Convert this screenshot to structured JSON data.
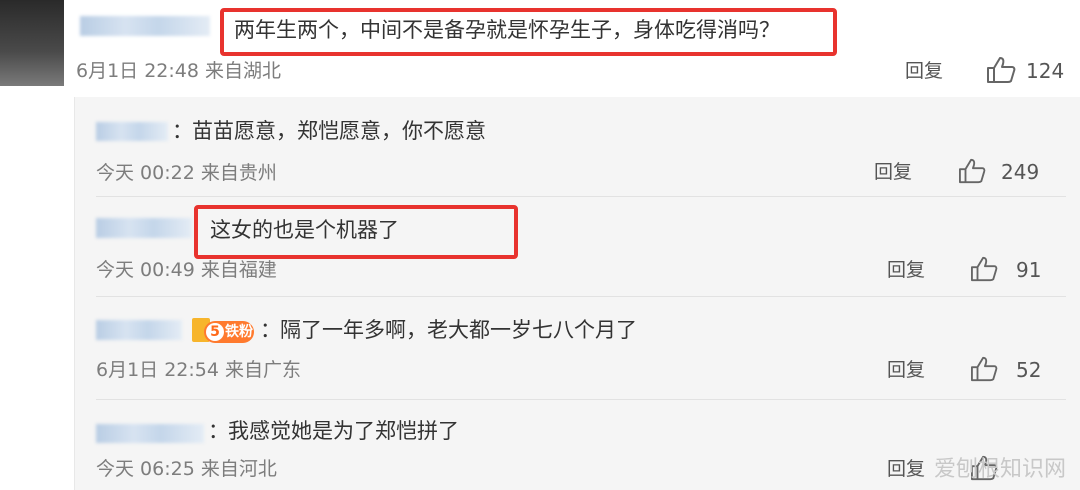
{
  "main_comment": {
    "text": "两年生两个，中间不是备孕就是怀孕生子，身体吃得消吗？",
    "meta": "6月1日 22:48 来自湖北",
    "reply_label": "回复",
    "likes": "124"
  },
  "replies": [
    {
      "separator": "：",
      "text": "苗苗愿意，郑恺愿意，你不愿意",
      "meta": "今天 00:22 来自贵州",
      "reply_label": "回复",
      "likes": "249"
    },
    {
      "separator": "",
      "text": "这女的也是个机器了",
      "meta": "今天 00:49 来自福建",
      "reply_label": "回复",
      "likes": "91"
    },
    {
      "separator": "：",
      "badge": {
        "level": "5",
        "label": "铁粉"
      },
      "text": "隔了一年多啊，老大都一岁七八个月了",
      "meta": "6月1日 22:54 来自广东",
      "reply_label": "回复",
      "likes": "52"
    },
    {
      "separator": "：",
      "text": "我感觉她是为了郑恺拼了",
      "meta": "今天 06:25 来自河北",
      "reply_label": "回复"
    }
  ],
  "watermark": "爱刨根知识网",
  "colors": {
    "highlight": "#e8332e",
    "panel_bg": "#f5f5f5",
    "meta_text": "#7d7d7d",
    "badge_orange": "#ff7a2e"
  },
  "icons": {
    "like": "thumbs-up-icon"
  }
}
